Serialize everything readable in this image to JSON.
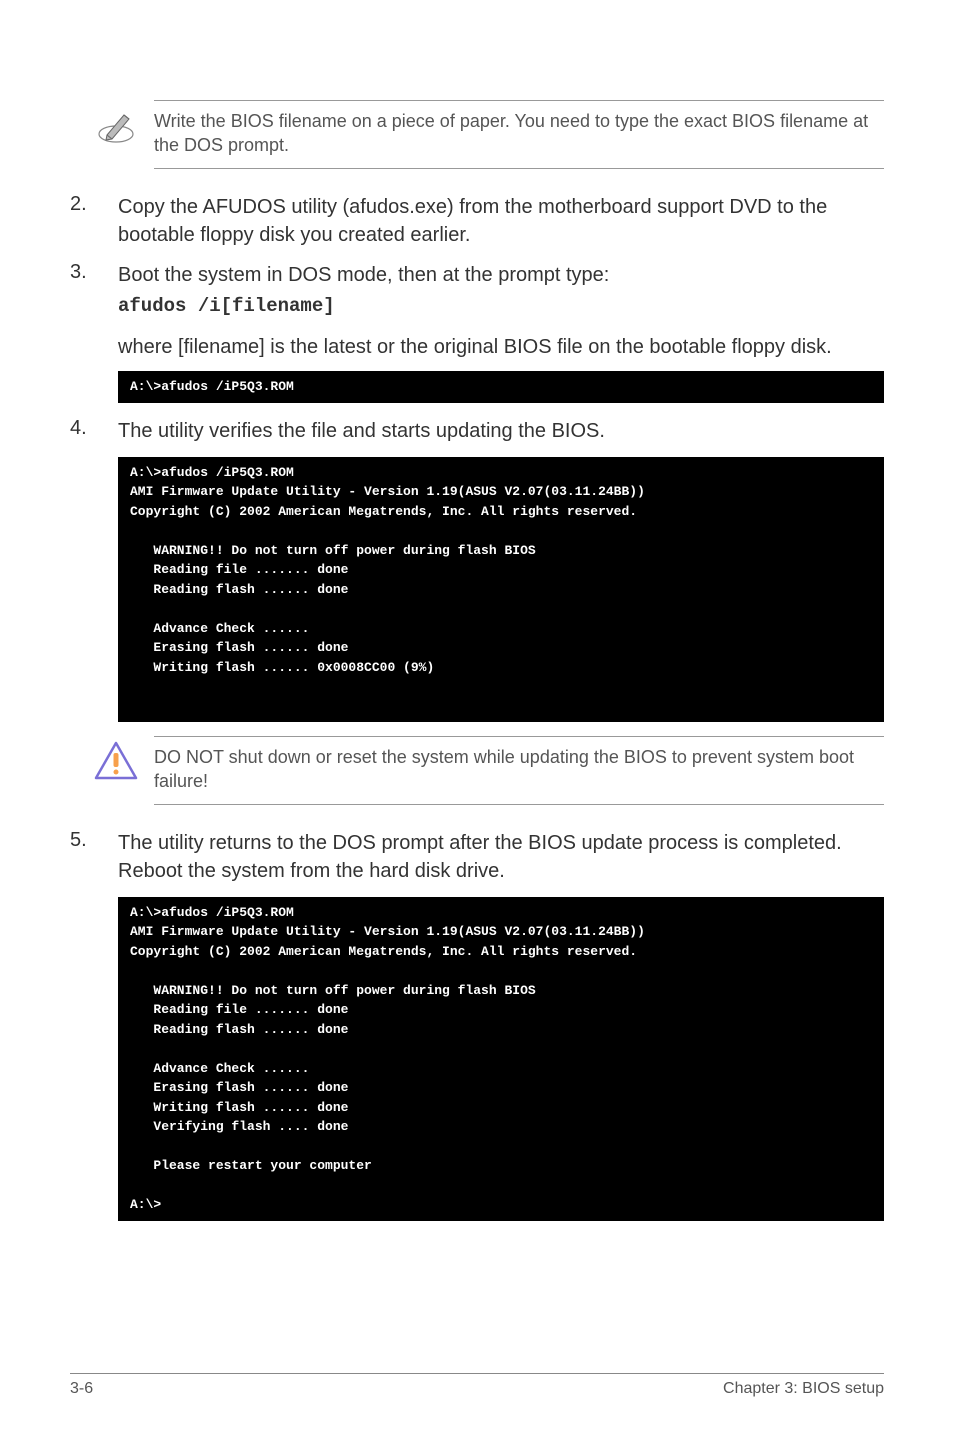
{
  "note1": {
    "text": "Write the BIOS filename on a piece of paper. You need to type the exact BIOS filename at the DOS prompt."
  },
  "steps": {
    "s2": {
      "num": "2.",
      "text": "Copy the AFUDOS utility (afudos.exe) from the motherboard support DVD to the bootable floppy disk you created earlier."
    },
    "s3": {
      "num": "3.",
      "text": "Boot the system in DOS mode, then at the prompt type:",
      "code": "afudos /i[filename]"
    },
    "s3_para": "where [filename] is the latest or the original BIOS file on the bootable floppy disk.",
    "s4": {
      "num": "4.",
      "text": "The utility verifies the file and starts updating the BIOS."
    },
    "s5": {
      "num": "5.",
      "text": "The utility returns to the DOS prompt after the BIOS update process is completed. Reboot the system from the hard disk drive."
    }
  },
  "terminal1": "A:\\>afudos /iP5Q3.ROM",
  "terminal2": "A:\\>afudos /iP5Q3.ROM\nAMI Firmware Update Utility - Version 1.19(ASUS V2.07(03.11.24BB))\nCopyright (C) 2002 American Megatrends, Inc. All rights reserved.\n\n   WARNING!! Do not turn off power during flash BIOS\n   Reading file ....... done\n   Reading flash ...... done\n\n   Advance Check ......\n   Erasing flash ...... done\n   Writing flash ...... 0x0008CC00 (9%)\n\n\n",
  "warning": {
    "text": "DO NOT shut down or reset the system while updating the BIOS to prevent system boot failure!"
  },
  "terminal3": "A:\\>afudos /iP5Q3.ROM\nAMI Firmware Update Utility - Version 1.19(ASUS V2.07(03.11.24BB))\nCopyright (C) 2002 American Megatrends, Inc. All rights reserved.\n\n   WARNING!! Do not turn off power during flash BIOS\n   Reading file ....... done\n   Reading flash ...... done\n\n   Advance Check ......\n   Erasing flash ...... done\n   Writing flash ...... done\n   Verifying flash .... done\n\n   Please restart your computer\n\nA:\\>",
  "footer": {
    "left": "3-6",
    "right": "Chapter 3: BIOS setup"
  }
}
